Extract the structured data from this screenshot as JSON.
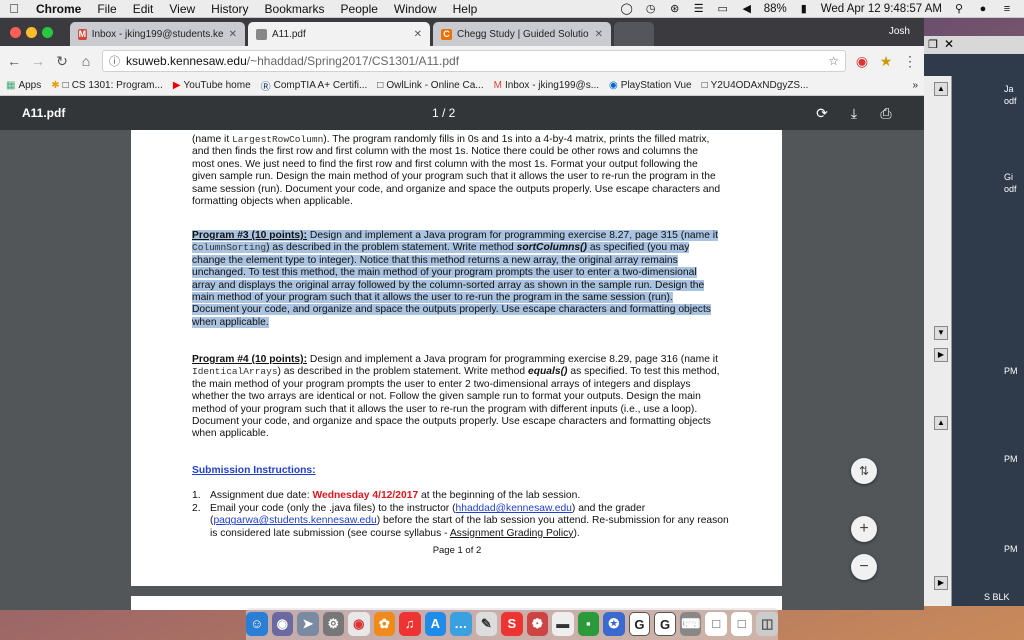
{
  "menubar": {
    "app": "Chrome",
    "items": [
      "File",
      "Edit",
      "View",
      "History",
      "Bookmarks",
      "People",
      "Window",
      "Help"
    ],
    "battery": "88%",
    "clock": "Wed Apr 12  9:48:57 AM"
  },
  "tabs": [
    {
      "label": "Inbox - jking199@students.ke",
      "icon": "gmail-icon"
    },
    {
      "label": "A11.pdf",
      "icon": "pdf-icon"
    },
    {
      "label": "Chegg Study | Guided Solutio",
      "icon": "chegg-icon"
    }
  ],
  "profile": "Josh",
  "omnibox": {
    "host": "ksuweb.kennesaw.edu",
    "path": "/~hhaddad/Spring2017/CS1301/A11.pdf"
  },
  "bookmarks": [
    {
      "label": "Apps"
    },
    {
      "label": "CS 1301: Program..."
    },
    {
      "label": "YouTube home"
    },
    {
      "label": "CompTIA A+ Certifi..."
    },
    {
      "label": "OwlLink - Online Ca..."
    },
    {
      "label": "Inbox - jking199@s..."
    },
    {
      "label": "PlayStation Vue"
    },
    {
      "label": "Y2U4ODAxNDgyZS..."
    }
  ],
  "pdf": {
    "title": "A11.pdf",
    "page_counter": "1 / 2",
    "p2": {
      "name_prefix": "(name it ",
      "code": "LargestRowColumn",
      "rest": "). The program randomly fills in 0s and 1s into a 4-by-4 matrix, prints the filled matrix, and then finds the first row and first column with the most 1s. Notice there could be other rows and columns the most ones. We just need to find the first row and first column with the most 1s. Format your output following the given sample run. Design the main method of your program such that it allows the user to re-run the program in the same session (run). Document your code, and organize and space the outputs properly. Use escape characters and formatting objects when applicable."
    },
    "p3": {
      "heading": "Program #3 (10 points):",
      "intro": " Design and implement a Java program for programming exercise 8.27, page 315 (name it ",
      "code": "ColumnSorting",
      "mid": ") as described in the problem statement. Write method ",
      "method": "sortColumns()",
      "rest": " as specified (you may change the element type to integer). Notice that this method returns a new array, the original array remains unchanged. To test this method, the main method of your program prompts the user to enter a two-dimensional array and displays the original array followed by the column-sorted array as shown in the sample run. Design the main method of your program such that it allows the user to re-run the program in the same session (run). Document your code, and organize and space the outputs properly. Use escape characters and formatting objects when applicable."
    },
    "p4": {
      "heading": "Program #4 (10 points):",
      "intro": " Design and implement a Java program for programming exercise 8.29, page 316 (name it ",
      "code": "IdenticalArrays",
      "mid": ") as described in the problem statement. Write method ",
      "method": "equals()",
      "rest": " as specified. To test this method, the main method of your program prompts the user to enter 2 two-dimensional arrays of integers and displays whether the two arrays are identical or not. Follow the given sample run to format your outputs. Design the main method of your program such that it allows the user to re-run the program with different inputs (i.e., use a loop). Document your code, and organize and space the outputs properly. Use escape characters and formatting objects when applicable."
    },
    "submission": {
      "heading": "Submission Instructions:",
      "item1_num": "1.",
      "item1_prefix": "Assignment due date: ",
      "item1_date": "Wednesday 4/12/2017",
      "item1_rest": " at the beginning of the lab session.",
      "item2_num": "2.",
      "item2_a": "Email your code (only the .java files) to the instructor (",
      "item2_email1": "hhaddad@kennesaw.edu",
      "item2_b": ") and the grader (",
      "item2_email2": "paggarwa@students.kennesaw.edu",
      "item2_c": ") before the start of the lab session you attend. Re-submission for any reason is considered late submission (see course syllabus - ",
      "item2_link": "Assignment Grading Policy",
      "item2_d": ")."
    },
    "footer": "Page 1 of 2"
  },
  "bg_labels": [
    "Ja",
    "odf",
    "Gi",
    "odf",
    "PM",
    "PM",
    "PM",
    "S BLK"
  ],
  "colors": {
    "highlight": "#a9c3e0",
    "link": "#1f3fd0",
    "due_date": "#e0161c",
    "pdf_toolbar": "#323639",
    "viewer_bg": "#525659"
  }
}
